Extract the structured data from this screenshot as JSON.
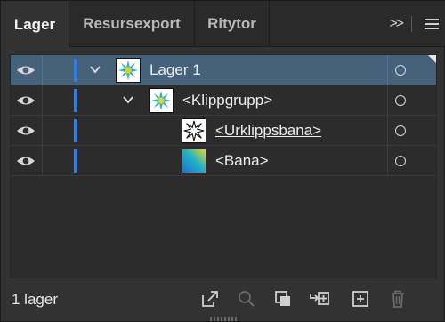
{
  "tabs": [
    {
      "label": "Lager",
      "active": true
    },
    {
      "label": "Resursexport",
      "active": false
    },
    {
      "label": "Ritytor",
      "active": false
    }
  ],
  "tab_icons": {
    "collapse": "collapse-panels-icon",
    "menu": "panel-menu-icon"
  },
  "layers": [
    {
      "name": "Lager 1",
      "thumbnail": "starburst-thumbnail",
      "selected": true,
      "expanded": true,
      "underline": false
    },
    {
      "name": "<Klippgrupp>",
      "thumbnail": "starburst-thumbnail",
      "selected": false,
      "expanded": true,
      "underline": false
    },
    {
      "name": "<Urklippsbana>",
      "thumbnail": "star-outline-thumbnail",
      "selected": false,
      "underline": true
    },
    {
      "name": "<Bana>",
      "thumbnail": "gradient-thumbnail",
      "selected": false,
      "underline": false
    }
  ],
  "layer_color": "#2f7ee6",
  "selection_color": "#46627a",
  "footer": {
    "count": "1 lager",
    "icons": [
      "export-icon",
      "locate-object-icon",
      "clipping-mask-icon",
      "new-sublayer-icon",
      "new-layer-icon",
      "delete-icon"
    ]
  }
}
